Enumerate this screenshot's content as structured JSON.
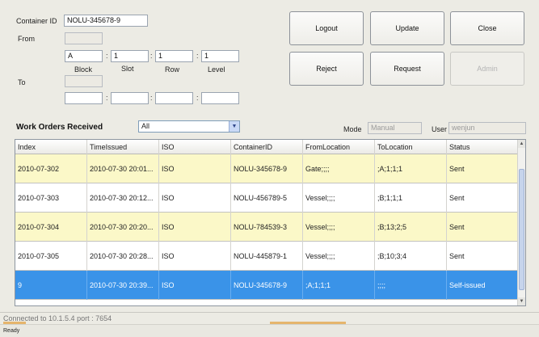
{
  "container": {
    "label": "Container ID",
    "value": "NOLU-345678-9"
  },
  "from": {
    "label": "From",
    "field_value": "",
    "block": "A",
    "slot": "1",
    "row": "1",
    "level": "1",
    "sep": ":",
    "col_labels": {
      "block": "Block",
      "slot": "Slot",
      "row": "Row",
      "level": "Level"
    }
  },
  "to": {
    "label": "To",
    "field_value": "",
    "block": "",
    "slot": "",
    "row": "",
    "level": "",
    "sep": ":"
  },
  "buttons": {
    "logout": "Logout",
    "update": "Update",
    "close": "Close",
    "reject": "Reject",
    "request": "Request",
    "admin": "Admin"
  },
  "orders": {
    "title": "Work Orders Received",
    "filter": "All",
    "arrow": "▼",
    "mode_label": "Mode",
    "mode_value": "Manual",
    "user_label": "User",
    "user_value": "wenjun"
  },
  "table": {
    "columns": [
      "Index",
      "TimeIssued",
      "ISO",
      "ContainerID",
      "FromLocation",
      "ToLocation",
      "Status"
    ],
    "rows": [
      [
        "2010-07-302",
        "2010-07-30 20:01...",
        "ISO",
        "NOLU-345678-9",
        "Gate;;;;",
        ";A;1;1;1",
        "Sent"
      ],
      [
        "2010-07-303",
        "2010-07-30 20:12...",
        "ISO",
        "NOLU-456789-5",
        "Vessel;;;;",
        ";B;1;1;1",
        "Sent"
      ],
      [
        "2010-07-304",
        "2010-07-30 20:20...",
        "ISO",
        "NOLU-784539-3",
        "Vessel;;;;",
        ";B;13;2;5",
        "Sent"
      ],
      [
        "2010-07-305",
        "2010-07-30 20:28...",
        "ISO",
        "NOLU-445879-1",
        "Vessel;;;;",
        ";B;10;3;4",
        "Sent"
      ],
      [
        "9",
        "2010-07-30 20:39...",
        "ISO",
        "NOLU-345678-9",
        ";A;1;1;1",
        ";;;;",
        "Self-issued"
      ]
    ]
  },
  "status": {
    "connection": "Connected to 10.1.5.4 port : 7654",
    "ready": "Ready"
  },
  "colors": {
    "row_yellow": "#fbf8c8",
    "row_selected": "#3a93e8",
    "background": "#ecebe4"
  }
}
